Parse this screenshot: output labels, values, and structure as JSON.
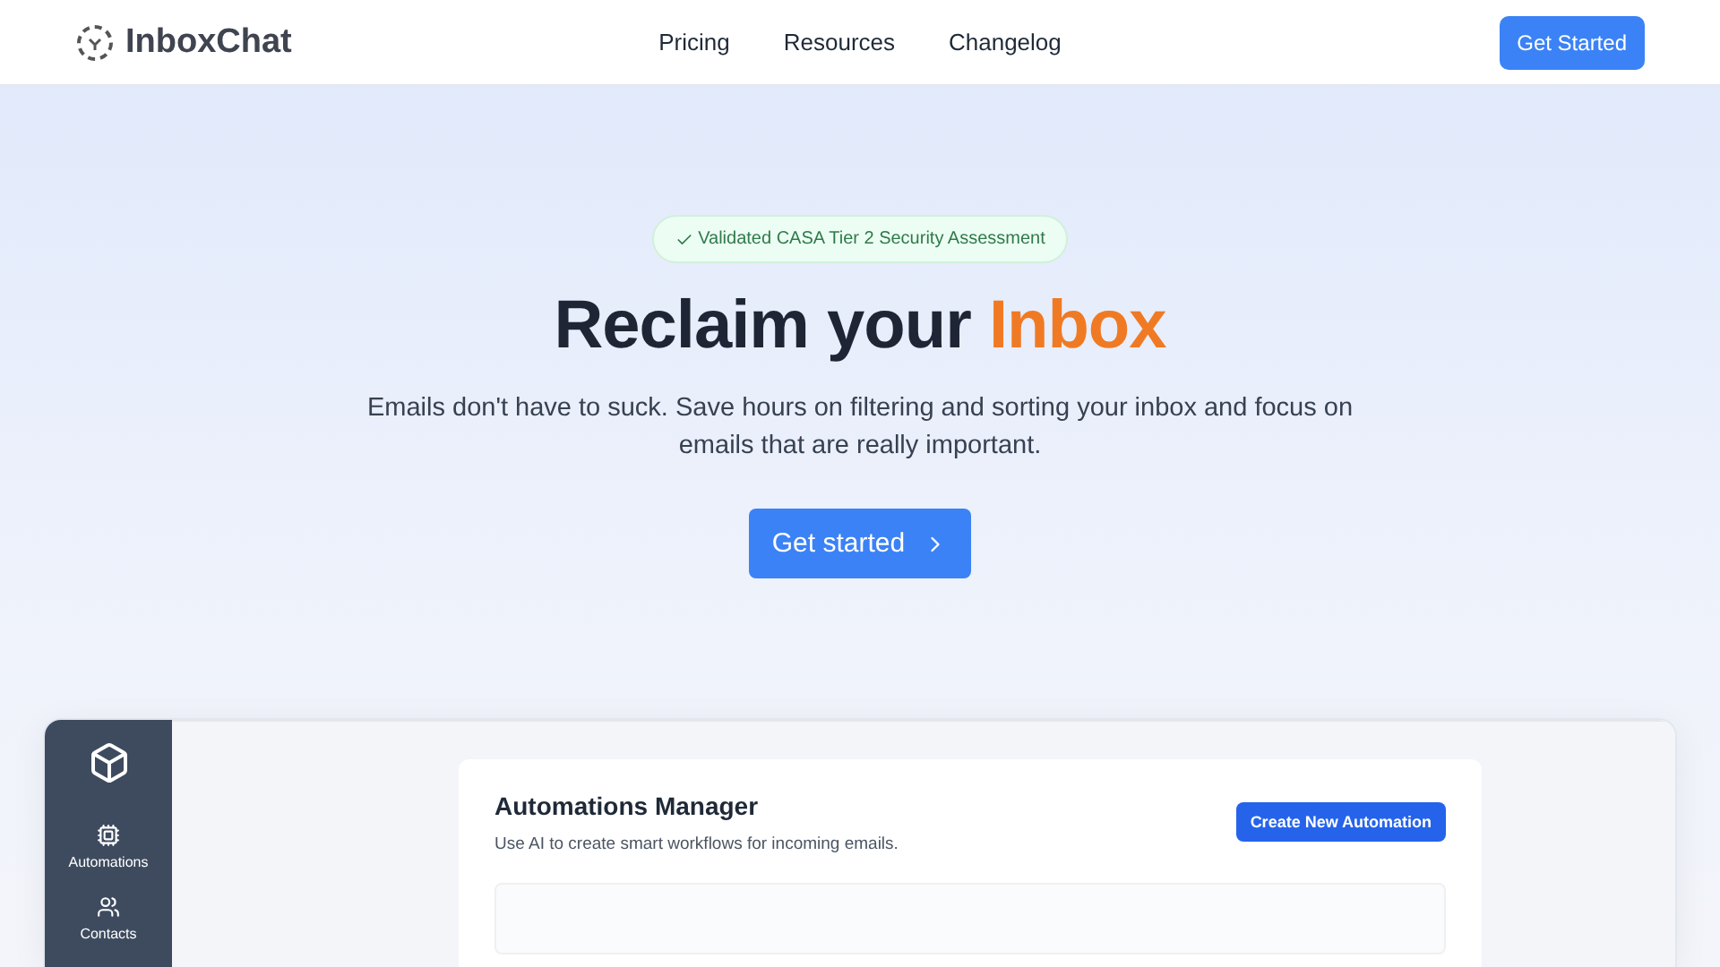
{
  "brand": {
    "name": "InboxChat"
  },
  "nav": [
    {
      "label": "Pricing"
    },
    {
      "label": "Resources"
    },
    {
      "label": "Changelog"
    }
  ],
  "header_cta": {
    "label": "Get Started"
  },
  "hero": {
    "badge": "Validated CASA Tier 2 Security Assessment",
    "title": "Reclaim your",
    "title_highlight": "Inbox",
    "subtitle": "Emails don't have to suck. Save hours on filtering and sorting your inbox and focus on emails that are really important.",
    "cta": "Get started"
  },
  "app_preview": {
    "sidebar": [
      {
        "label": "Automations",
        "kind": "chip"
      },
      {
        "label": "Contacts",
        "kind": "people"
      }
    ],
    "card": {
      "title": "Automations Manager",
      "description": "Use AI to create smart workflows for incoming emails.",
      "button": "Create New Automation"
    }
  }
}
